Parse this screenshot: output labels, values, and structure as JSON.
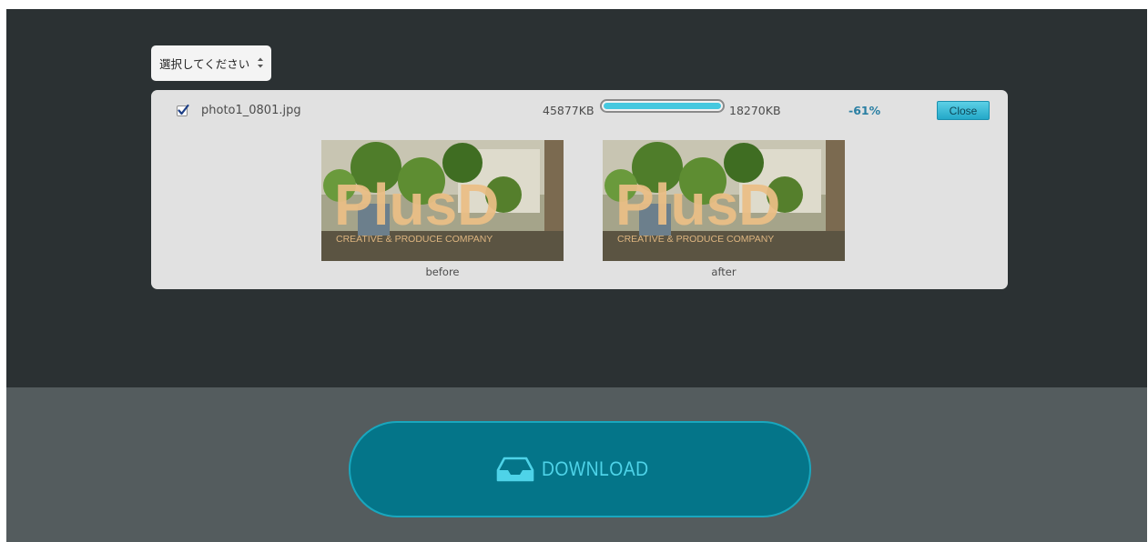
{
  "select": {
    "label": "選択してください"
  },
  "file": {
    "checked": true,
    "name": "photo1_0801.jpg",
    "size_before": "45877KB",
    "size_after": "18270KB",
    "reduction": "-61%",
    "progress_percent": 100,
    "close_label": "Close"
  },
  "thumbnails": {
    "before_caption": "before",
    "after_caption": "after",
    "logo_text": "PlusD",
    "logo_subtitle": "CREATIVE & PRODUCE COMPANY"
  },
  "download": {
    "label": "DOWNLOAD"
  },
  "colors": {
    "top_bg": "#2b3133",
    "bottom_bg": "#545c5e",
    "accent": "#45c8df",
    "button_bg": "#047589",
    "button_text": "#4ed3e8"
  }
}
